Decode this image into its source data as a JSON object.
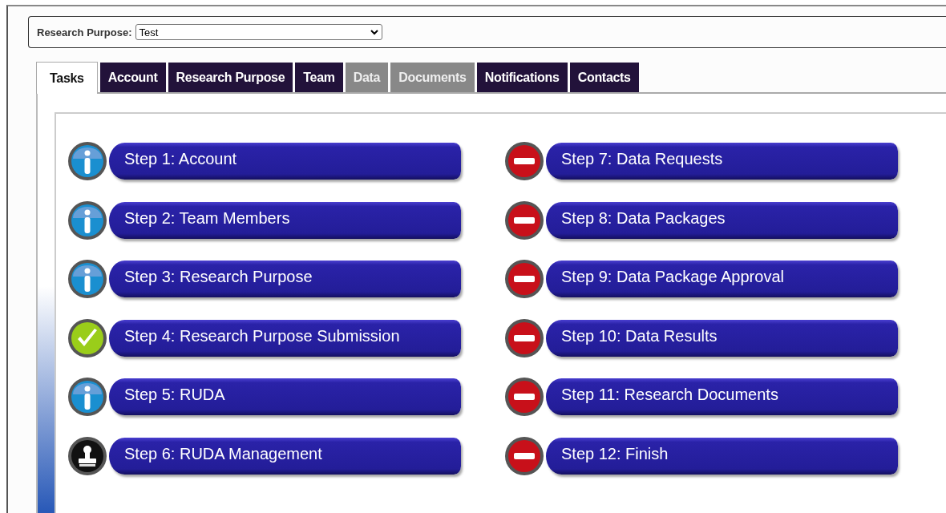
{
  "header": {
    "label": "Research Purpose:",
    "value": "Test"
  },
  "tabs": [
    {
      "label": "Tasks",
      "selected": true,
      "disabled": false
    },
    {
      "label": "Account",
      "selected": false,
      "disabled": false
    },
    {
      "label": "Research Purpose",
      "selected": false,
      "disabled": false
    },
    {
      "label": "Team",
      "selected": false,
      "disabled": false
    },
    {
      "label": "Data",
      "selected": false,
      "disabled": true
    },
    {
      "label": "Documents",
      "selected": false,
      "disabled": true
    },
    {
      "label": "Notifications",
      "selected": false,
      "disabled": false
    },
    {
      "label": "Contacts",
      "selected": false,
      "disabled": false
    }
  ],
  "steps": [
    {
      "label": "Step 1: Account",
      "kind": "info"
    },
    {
      "label": "Step 2: Team Members",
      "kind": "info"
    },
    {
      "label": "Step 3: Research Purpose",
      "kind": "info"
    },
    {
      "label": "Step 4: Research Purpose Submission",
      "kind": "complete"
    },
    {
      "label": "Step 5: RUDA",
      "kind": "info"
    },
    {
      "label": "Step 6: RUDA Management",
      "kind": "stamp"
    },
    {
      "label": "Step 7: Data Requests",
      "kind": "blocked"
    },
    {
      "label": "Step 8: Data Packages",
      "kind": "blocked"
    },
    {
      "label": "Step 9: Data Package Approval",
      "kind": "blocked"
    },
    {
      "label": "Step 10: Data Results",
      "kind": "blocked"
    },
    {
      "label": "Step 11: Research Documents",
      "kind": "blocked"
    },
    {
      "label": "Step 12: Finish",
      "kind": "blocked"
    }
  ]
}
